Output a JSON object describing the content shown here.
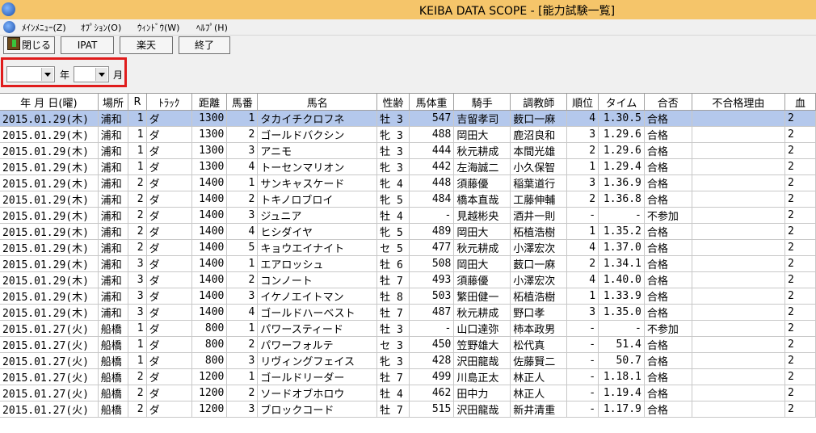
{
  "window": {
    "title": "KEIBA DATA SCOPE - [能力試験一覧]"
  },
  "menu": [
    "ﾒｲﾝﾒﾆｭｰ(Z)",
    "ｵﾌﾟｼｮﾝ(O)",
    "ｳｨﾝﾄﾞｳ(W)",
    "ﾍﾙﾌﾟ(H)"
  ],
  "toolbar": {
    "close": "閉じる",
    "ipat": "IPAT",
    "rakuten": "楽天",
    "exit": "終了"
  },
  "filter": {
    "year_value": "",
    "year_unit": "年",
    "month_value": "",
    "month_unit": "月"
  },
  "columns": [
    "年 月 日(曜)",
    "場所",
    "R",
    "ﾄﾗｯｸ",
    "距離",
    "馬番",
    "馬名",
    "性齢",
    "馬体重",
    "騎手",
    "調教師",
    "順位",
    "タイム",
    "合否",
    "不合格理由",
    "血"
  ],
  "rows": [
    [
      "2015.01.29(木)",
      "浦和",
      "1",
      "ダ",
      "1300",
      "1",
      "タカイチクロフネ",
      "牡 3",
      "547",
      "吉留孝司",
      "薮口一麻",
      "4",
      "1.30.5",
      "合格",
      "",
      "2"
    ],
    [
      "2015.01.29(木)",
      "浦和",
      "1",
      "ダ",
      "1300",
      "2",
      "ゴールドバクシン",
      "牝 3",
      "488",
      "岡田大",
      "鹿沼良和",
      "3",
      "1.29.6",
      "合格",
      "",
      "2"
    ],
    [
      "2015.01.29(木)",
      "浦和",
      "1",
      "ダ",
      "1300",
      "3",
      "アニモ",
      "牡 3",
      "444",
      "秋元耕成",
      "本間光雄",
      "2",
      "1.29.6",
      "合格",
      "",
      "2"
    ],
    [
      "2015.01.29(木)",
      "浦和",
      "1",
      "ダ",
      "1300",
      "4",
      "トーセンマリオン",
      "牝 3",
      "442",
      "左海誠二",
      "小久保智",
      "1",
      "1.29.4",
      "合格",
      "",
      "2"
    ],
    [
      "2015.01.29(木)",
      "浦和",
      "2",
      "ダ",
      "1400",
      "1",
      "サンキャスケード",
      "牝 4",
      "448",
      "須藤優",
      "稲葉道行",
      "3",
      "1.36.9",
      "合格",
      "",
      "2"
    ],
    [
      "2015.01.29(木)",
      "浦和",
      "2",
      "ダ",
      "1400",
      "2",
      "トキノロブロイ",
      "牝 5",
      "484",
      "橋本直哉",
      "工藤伸輔",
      "2",
      "1.36.8",
      "合格",
      "",
      "2"
    ],
    [
      "2015.01.29(木)",
      "浦和",
      "2",
      "ダ",
      "1400",
      "3",
      "ジュニア",
      "牡 4",
      "-",
      "見越彬央",
      "酒井一則",
      "-",
      "-",
      "不参加",
      "",
      "2"
    ],
    [
      "2015.01.29(木)",
      "浦和",
      "2",
      "ダ",
      "1400",
      "4",
      "ヒシダイヤ",
      "牝 5",
      "489",
      "岡田大",
      "柘植浩樹",
      "1",
      "1.35.2",
      "合格",
      "",
      "2"
    ],
    [
      "2015.01.29(木)",
      "浦和",
      "2",
      "ダ",
      "1400",
      "5",
      "キョウエイナイト",
      "セ 5",
      "477",
      "秋元耕成",
      "小澤宏次",
      "4",
      "1.37.0",
      "合格",
      "",
      "2"
    ],
    [
      "2015.01.29(木)",
      "浦和",
      "3",
      "ダ",
      "1400",
      "1",
      "エアロッシュ",
      "牡 6",
      "508",
      "岡田大",
      "薮口一麻",
      "2",
      "1.34.1",
      "合格",
      "",
      "2"
    ],
    [
      "2015.01.29(木)",
      "浦和",
      "3",
      "ダ",
      "1400",
      "2",
      "コンノート",
      "牡 7",
      "493",
      "須藤優",
      "小澤宏次",
      "4",
      "1.40.0",
      "合格",
      "",
      "2"
    ],
    [
      "2015.01.29(木)",
      "浦和",
      "3",
      "ダ",
      "1400",
      "3",
      "イケノエイトマン",
      "牡 8",
      "503",
      "繁田健一",
      "柘植浩樹",
      "1",
      "1.33.9",
      "合格",
      "",
      "2"
    ],
    [
      "2015.01.29(木)",
      "浦和",
      "3",
      "ダ",
      "1400",
      "4",
      "ゴールドハーベスト",
      "牡 7",
      "487",
      "秋元耕成",
      "野口孝",
      "3",
      "1.35.0",
      "合格",
      "",
      "2"
    ],
    [
      "2015.01.27(火)",
      "船橋",
      "1",
      "ダ",
      "800",
      "1",
      "パワースティード",
      "牡 3",
      "-",
      "山口達弥",
      "柿本政男",
      "-",
      "-",
      "不参加",
      "",
      "2"
    ],
    [
      "2015.01.27(火)",
      "船橋",
      "1",
      "ダ",
      "800",
      "2",
      "パワーフォルテ",
      "セ 3",
      "450",
      "笠野雄大",
      "松代真",
      "-",
      "51.4",
      "合格",
      "",
      "2"
    ],
    [
      "2015.01.27(火)",
      "船橋",
      "1",
      "ダ",
      "800",
      "3",
      "リヴィングフェイス",
      "牝 3",
      "428",
      "沢田龍哉",
      "佐藤賢二",
      "-",
      "50.7",
      "合格",
      "",
      "2"
    ],
    [
      "2015.01.27(火)",
      "船橋",
      "2",
      "ダ",
      "1200",
      "1",
      "ゴールドリーダー",
      "牡 7",
      "499",
      "川島正太",
      "林正人",
      "-",
      "1.18.1",
      "合格",
      "",
      "2"
    ],
    [
      "2015.01.27(火)",
      "船橋",
      "2",
      "ダ",
      "1200",
      "2",
      "ソードオブホロウ",
      "牡 4",
      "462",
      "田中力",
      "林正人",
      "-",
      "1.19.4",
      "合格",
      "",
      "2"
    ],
    [
      "2015.01.27(火)",
      "船橋",
      "2",
      "ダ",
      "1200",
      "3",
      "ブロックコード",
      "牡 7",
      "515",
      "沢田龍哉",
      "新井清重",
      "-",
      "1.17.9",
      "合格",
      "",
      "2"
    ]
  ],
  "selected_row": 0
}
